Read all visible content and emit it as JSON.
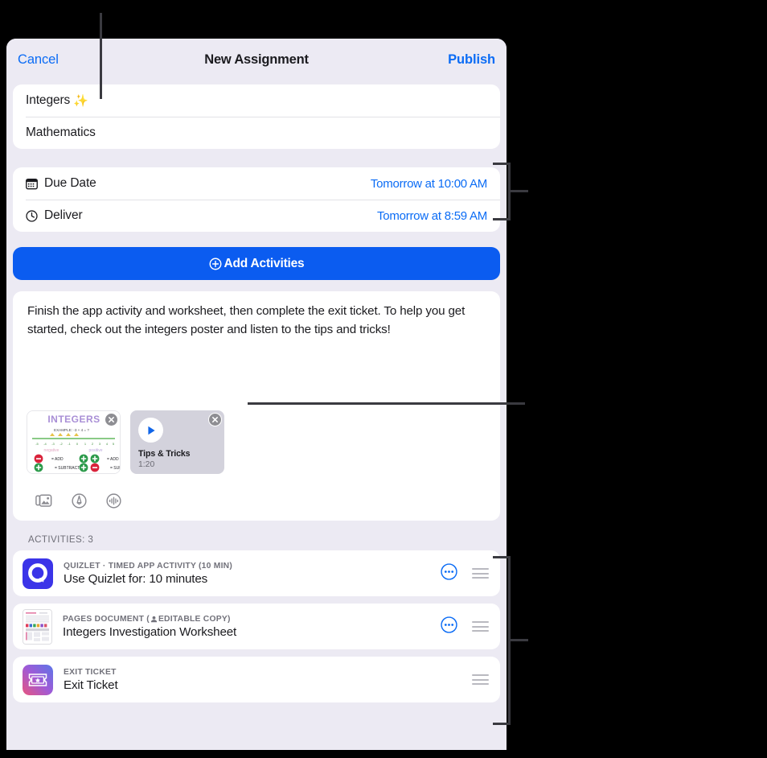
{
  "navbar": {
    "cancel_label": "Cancel",
    "title": "New Assignment",
    "publish_label": "Publish"
  },
  "details": {
    "title_value": "Integers",
    "title_emoji": "✨",
    "subject_value": "Mathematics"
  },
  "dates": {
    "rows": [
      {
        "icon": "calendar-icon",
        "label": "Due Date",
        "value": "Tomorrow at 10:00 AM"
      },
      {
        "icon": "clock-icon",
        "label": "Deliver",
        "value": "Tomorrow at 8:59 AM"
      }
    ]
  },
  "add_activities": {
    "label": "Add Activities",
    "icon": "plus-circle-icon",
    "accent": "#0b5cf0"
  },
  "instructions": {
    "text": "Finish the app activity and worksheet, then complete the exit ticket. To help you get started, check out the integers poster and listen to the tips and tricks!",
    "attachments": [
      {
        "type": "image",
        "name": "integers-poster",
        "poster_title": "INTEGERS",
        "poster_example": "EXAMPLE: -3 + 4 = ?",
        "poster_left_label": "negative",
        "poster_right_label": "positive",
        "poster_ops": [
          "ADD",
          "SUBTRACT",
          "ADD",
          "SUBTRACT"
        ],
        "remove_icon": "close-circle-icon"
      },
      {
        "type": "video",
        "name": "tips-and-tricks-video",
        "title": "Tips & Tricks",
        "duration": "1:20",
        "play_icon": "play-icon",
        "remove_icon": "close-circle-icon"
      }
    ],
    "tools": [
      {
        "name": "photo-library-icon",
        "label": "Photo Library"
      },
      {
        "name": "markup-icon",
        "label": "Markup"
      },
      {
        "name": "audio-recording-icon",
        "label": "Record Audio"
      }
    ]
  },
  "activities": {
    "header": "ACTIVITIES: 3",
    "count": 3,
    "items": [
      {
        "icon": "quizlet-app-icon",
        "icon_color": "#3b34e8",
        "kicker": "QUIZLET · TIMED APP ACTIVITY (10 MIN)",
        "title": "Use Quizlet for: 10 minutes",
        "has_more": true,
        "more_icon": "more-circle-icon",
        "grip_icon": "reorder-grip-icon"
      },
      {
        "icon": "pages-document-thumbnail",
        "kicker_prefix": "PAGES DOCUMENT  (",
        "kicker_badge_icon": "person-icon",
        "kicker_suffix": " EDITABLE COPY)",
        "kicker": "PAGES DOCUMENT  ( EDITABLE COPY)",
        "title": "Integers Investigation Worksheet",
        "has_more": true,
        "more_icon": "more-circle-icon",
        "grip_icon": "reorder-grip-icon"
      },
      {
        "icon": "exit-ticket-icon",
        "kicker": "EXIT TICKET",
        "title": "Exit Ticket",
        "has_more": false,
        "grip_icon": "reorder-grip-icon"
      }
    ]
  }
}
